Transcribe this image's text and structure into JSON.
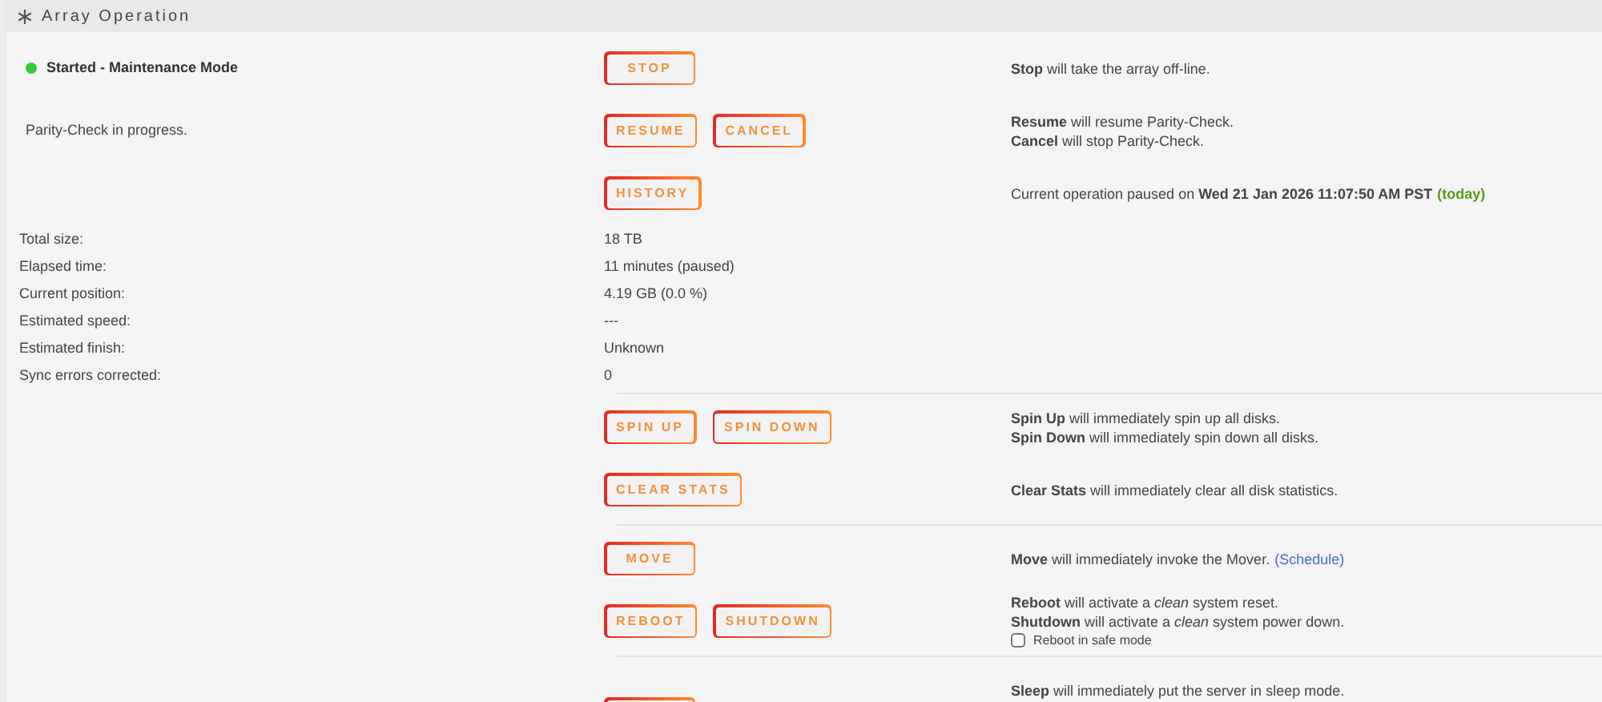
{
  "header": {
    "title": "Array Operation"
  },
  "top_rows": [
    {
      "status": {
        "text": "Started - Maintenance Mode",
        "color": "#33cc33"
      },
      "buttons": [
        {
          "label": "STOP"
        }
      ],
      "lines": [
        {
          "text": "**Stop** will take the array off-line."
        }
      ]
    },
    {
      "left": "Parity-Check in progress.",
      "buttons": [
        {
          "label": "RESUME"
        },
        {
          "label": "CANCEL"
        }
      ],
      "lines": [
        {
          "text": "**Resume** will resume Parity-Check."
        },
        {
          "text": "**Cancel** will stop Parity-Check."
        }
      ]
    },
    {
      "buttons": [
        {
          "label": "HISTORY"
        }
      ],
      "lines": [
        {
          "text": "Current operation paused on **Wed 21 Jan 2026 11:07:50 AM PST**",
          "note": "(today)"
        }
      ]
    }
  ],
  "stats": [
    {
      "label": "Total size:",
      "value": "18 TB"
    },
    {
      "label": "Elapsed time:",
      "value": "11 minutes (paused)"
    },
    {
      "label": "Current position:",
      "value": "4.19 GB (0.0 %)"
    },
    {
      "label": "Estimated speed:",
      "value": "---"
    },
    {
      "label": "Estimated finish:",
      "value": "Unknown"
    },
    {
      "label": "Sync errors corrected:",
      "value": "0"
    }
  ],
  "groups": [
    [
      {
        "buttons": [
          {
            "label": "SPIN UP"
          },
          {
            "label": "SPIN DOWN"
          }
        ],
        "lines": [
          {
            "text": "**Spin Up** will immediately spin up all disks."
          },
          {
            "text": "**Spin Down** will immediately spin down all disks."
          }
        ]
      },
      {
        "buttons": [
          {
            "label": "CLEAR STATS"
          }
        ],
        "lines": [
          {
            "text": "**Clear Stats** will immediately clear all disk statistics."
          }
        ]
      }
    ],
    [
      {
        "buttons": [
          {
            "label": "MOVE"
          }
        ],
        "lines": [
          {
            "text": "**Move** will immediately invoke the Mover.",
            "link": "(Schedule)"
          }
        ]
      },
      {
        "buttons": [
          {
            "label": "REBOOT"
          },
          {
            "label": "SHUTDOWN"
          }
        ],
        "lines": [
          {
            "text": "**Reboot** will activate a *clean* system reset."
          },
          {
            "text": "**Shutdown** will activate a *clean* system power down."
          }
        ],
        "checkbox": {
          "label": "Reboot in safe mode",
          "checked": false
        }
      }
    ],
    [
      {
        "buttons": [
          {
            "kind": "clipped"
          }
        ],
        "lines": [
          {
            "text": "**Sleep** will immediately put the server in sleep mode."
          }
        ]
      }
    ]
  ]
}
